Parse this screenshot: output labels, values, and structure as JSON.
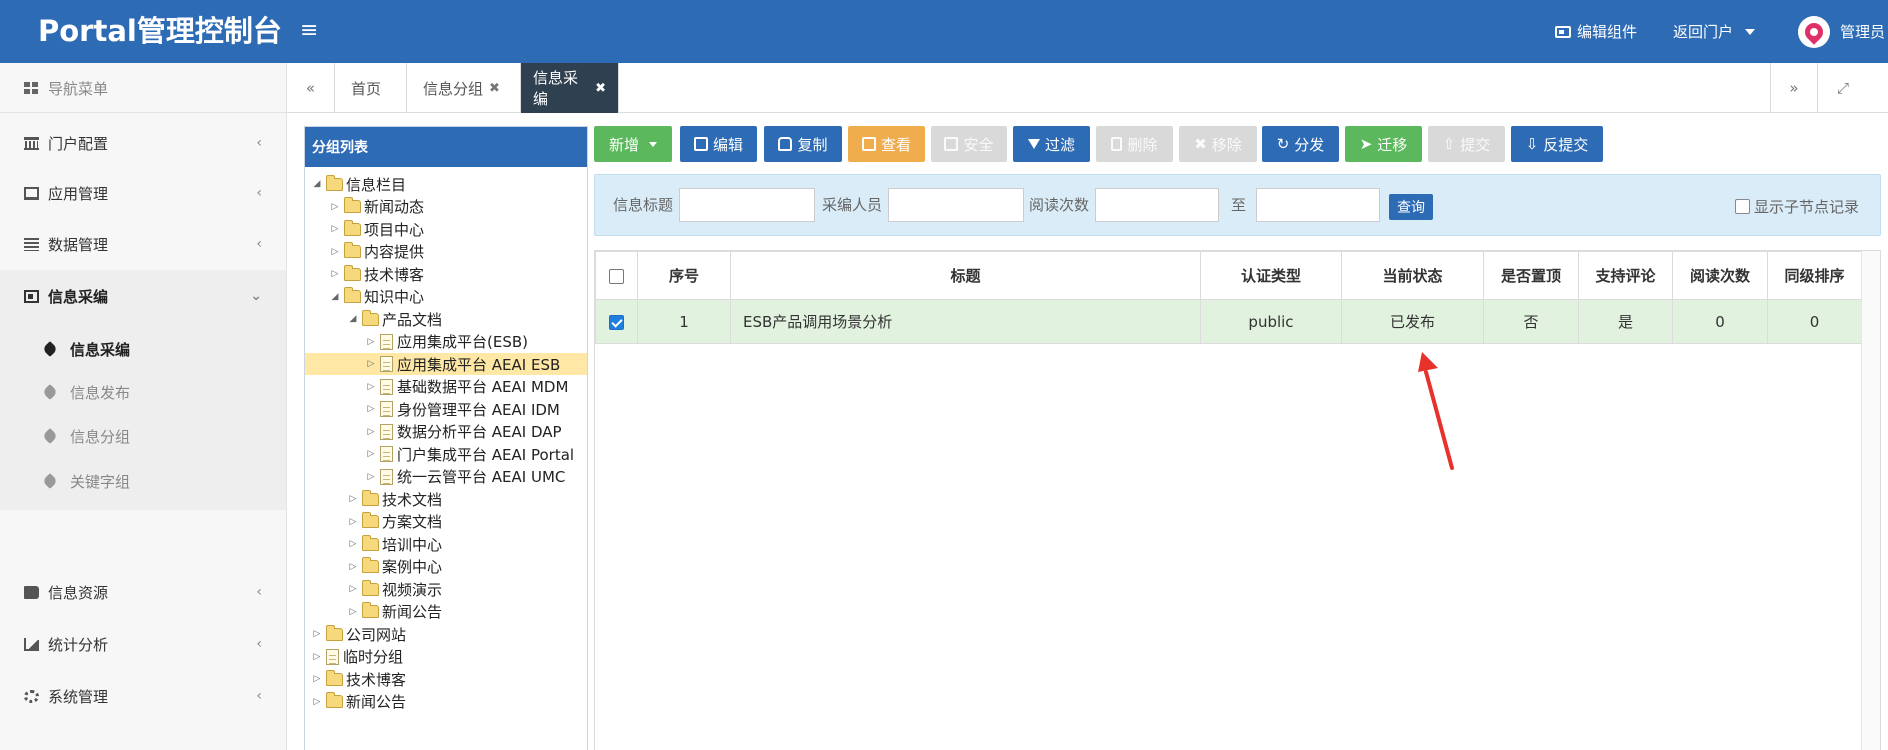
{
  "header": {
    "brand": "Portal管理控制台",
    "menu_toggle": "≡",
    "edit_widget": "编辑组件",
    "back_portal": "返回门户",
    "user": "管理员"
  },
  "sidebar": {
    "nav_title": "导航菜单",
    "items": [
      {
        "label": "门户配置",
        "icon": "bank-icon"
      },
      {
        "label": "应用管理",
        "icon": "laptop-icon"
      },
      {
        "label": "数据管理",
        "icon": "list-icon"
      },
      {
        "label": "信息采编",
        "icon": "card-icon"
      },
      {
        "label": "信息资源",
        "icon": "book-icon"
      },
      {
        "label": "统计分析",
        "icon": "chart-icon"
      },
      {
        "label": "系统管理",
        "icon": "gear-icon"
      }
    ],
    "subitems": [
      {
        "label": "信息采编"
      },
      {
        "label": "信息发布"
      },
      {
        "label": "信息分组"
      },
      {
        "label": "关键字组"
      }
    ]
  },
  "tabs": [
    {
      "label": "首页"
    },
    {
      "label": "信息分组"
    },
    {
      "label": "信息采编"
    }
  ],
  "group_panel": {
    "title": "分组列表",
    "tree": [
      {
        "label": "信息栏目"
      },
      {
        "label": "新闻动态"
      },
      {
        "label": "项目中心"
      },
      {
        "label": "内容提供"
      },
      {
        "label": "技术博客"
      },
      {
        "label": "知识中心"
      },
      {
        "label": "产品文档"
      },
      {
        "label": "应用集成平台(ESB)"
      },
      {
        "label": "应用集成平台 AEAI ESB"
      },
      {
        "label": "基础数据平台 AEAI MDM"
      },
      {
        "label": "身份管理平台 AEAI IDM"
      },
      {
        "label": "数据分析平台 AEAI DAP"
      },
      {
        "label": "门户集成平台 AEAI Portal"
      },
      {
        "label": "统一云管平台 AEAI UMC"
      },
      {
        "label": "技术文档"
      },
      {
        "label": "方案文档"
      },
      {
        "label": "培训中心"
      },
      {
        "label": "案例中心"
      },
      {
        "label": "视频演示"
      },
      {
        "label": "新闻公告"
      },
      {
        "label": "公司网站"
      },
      {
        "label": "临时分组"
      },
      {
        "label": "技术博客"
      },
      {
        "label": "新闻公告"
      }
    ]
  },
  "toolbar": {
    "add": "新增",
    "edit": "编辑",
    "copy": "复制",
    "view": "查看",
    "security": "安全",
    "filter": "过滤",
    "delete": "删除",
    "remove": "移除",
    "distribute": "分发",
    "migrate": "迁移",
    "submit": "提交",
    "unsubmit": "反提交"
  },
  "search": {
    "title_label": "信息标题",
    "title_value": "",
    "editor_label": "采编人员",
    "editor_value": "",
    "reads_label": "阅读次数",
    "reads_from": "",
    "to_label": "至",
    "reads_to": "",
    "query_button": "查询",
    "show_children": "显示子节点记录"
  },
  "grid": {
    "columns": [
      "序号",
      "标题",
      "认证类型",
      "当前状态",
      "是否置顶",
      "支持评论",
      "阅读次数",
      "同级排序"
    ],
    "rows": [
      {
        "index": "1",
        "title": "ESB产品调用场景分析",
        "auth_type": "public",
        "status": "已发布",
        "top": "否",
        "comment": "是",
        "reads": "0",
        "order": "0"
      }
    ]
  },
  "colors": {
    "header_bg": "#2e6bb5",
    "active_tab": "#2f4050",
    "row_selected": "#e1f2df",
    "annotation_arrow": "#e8312a"
  }
}
